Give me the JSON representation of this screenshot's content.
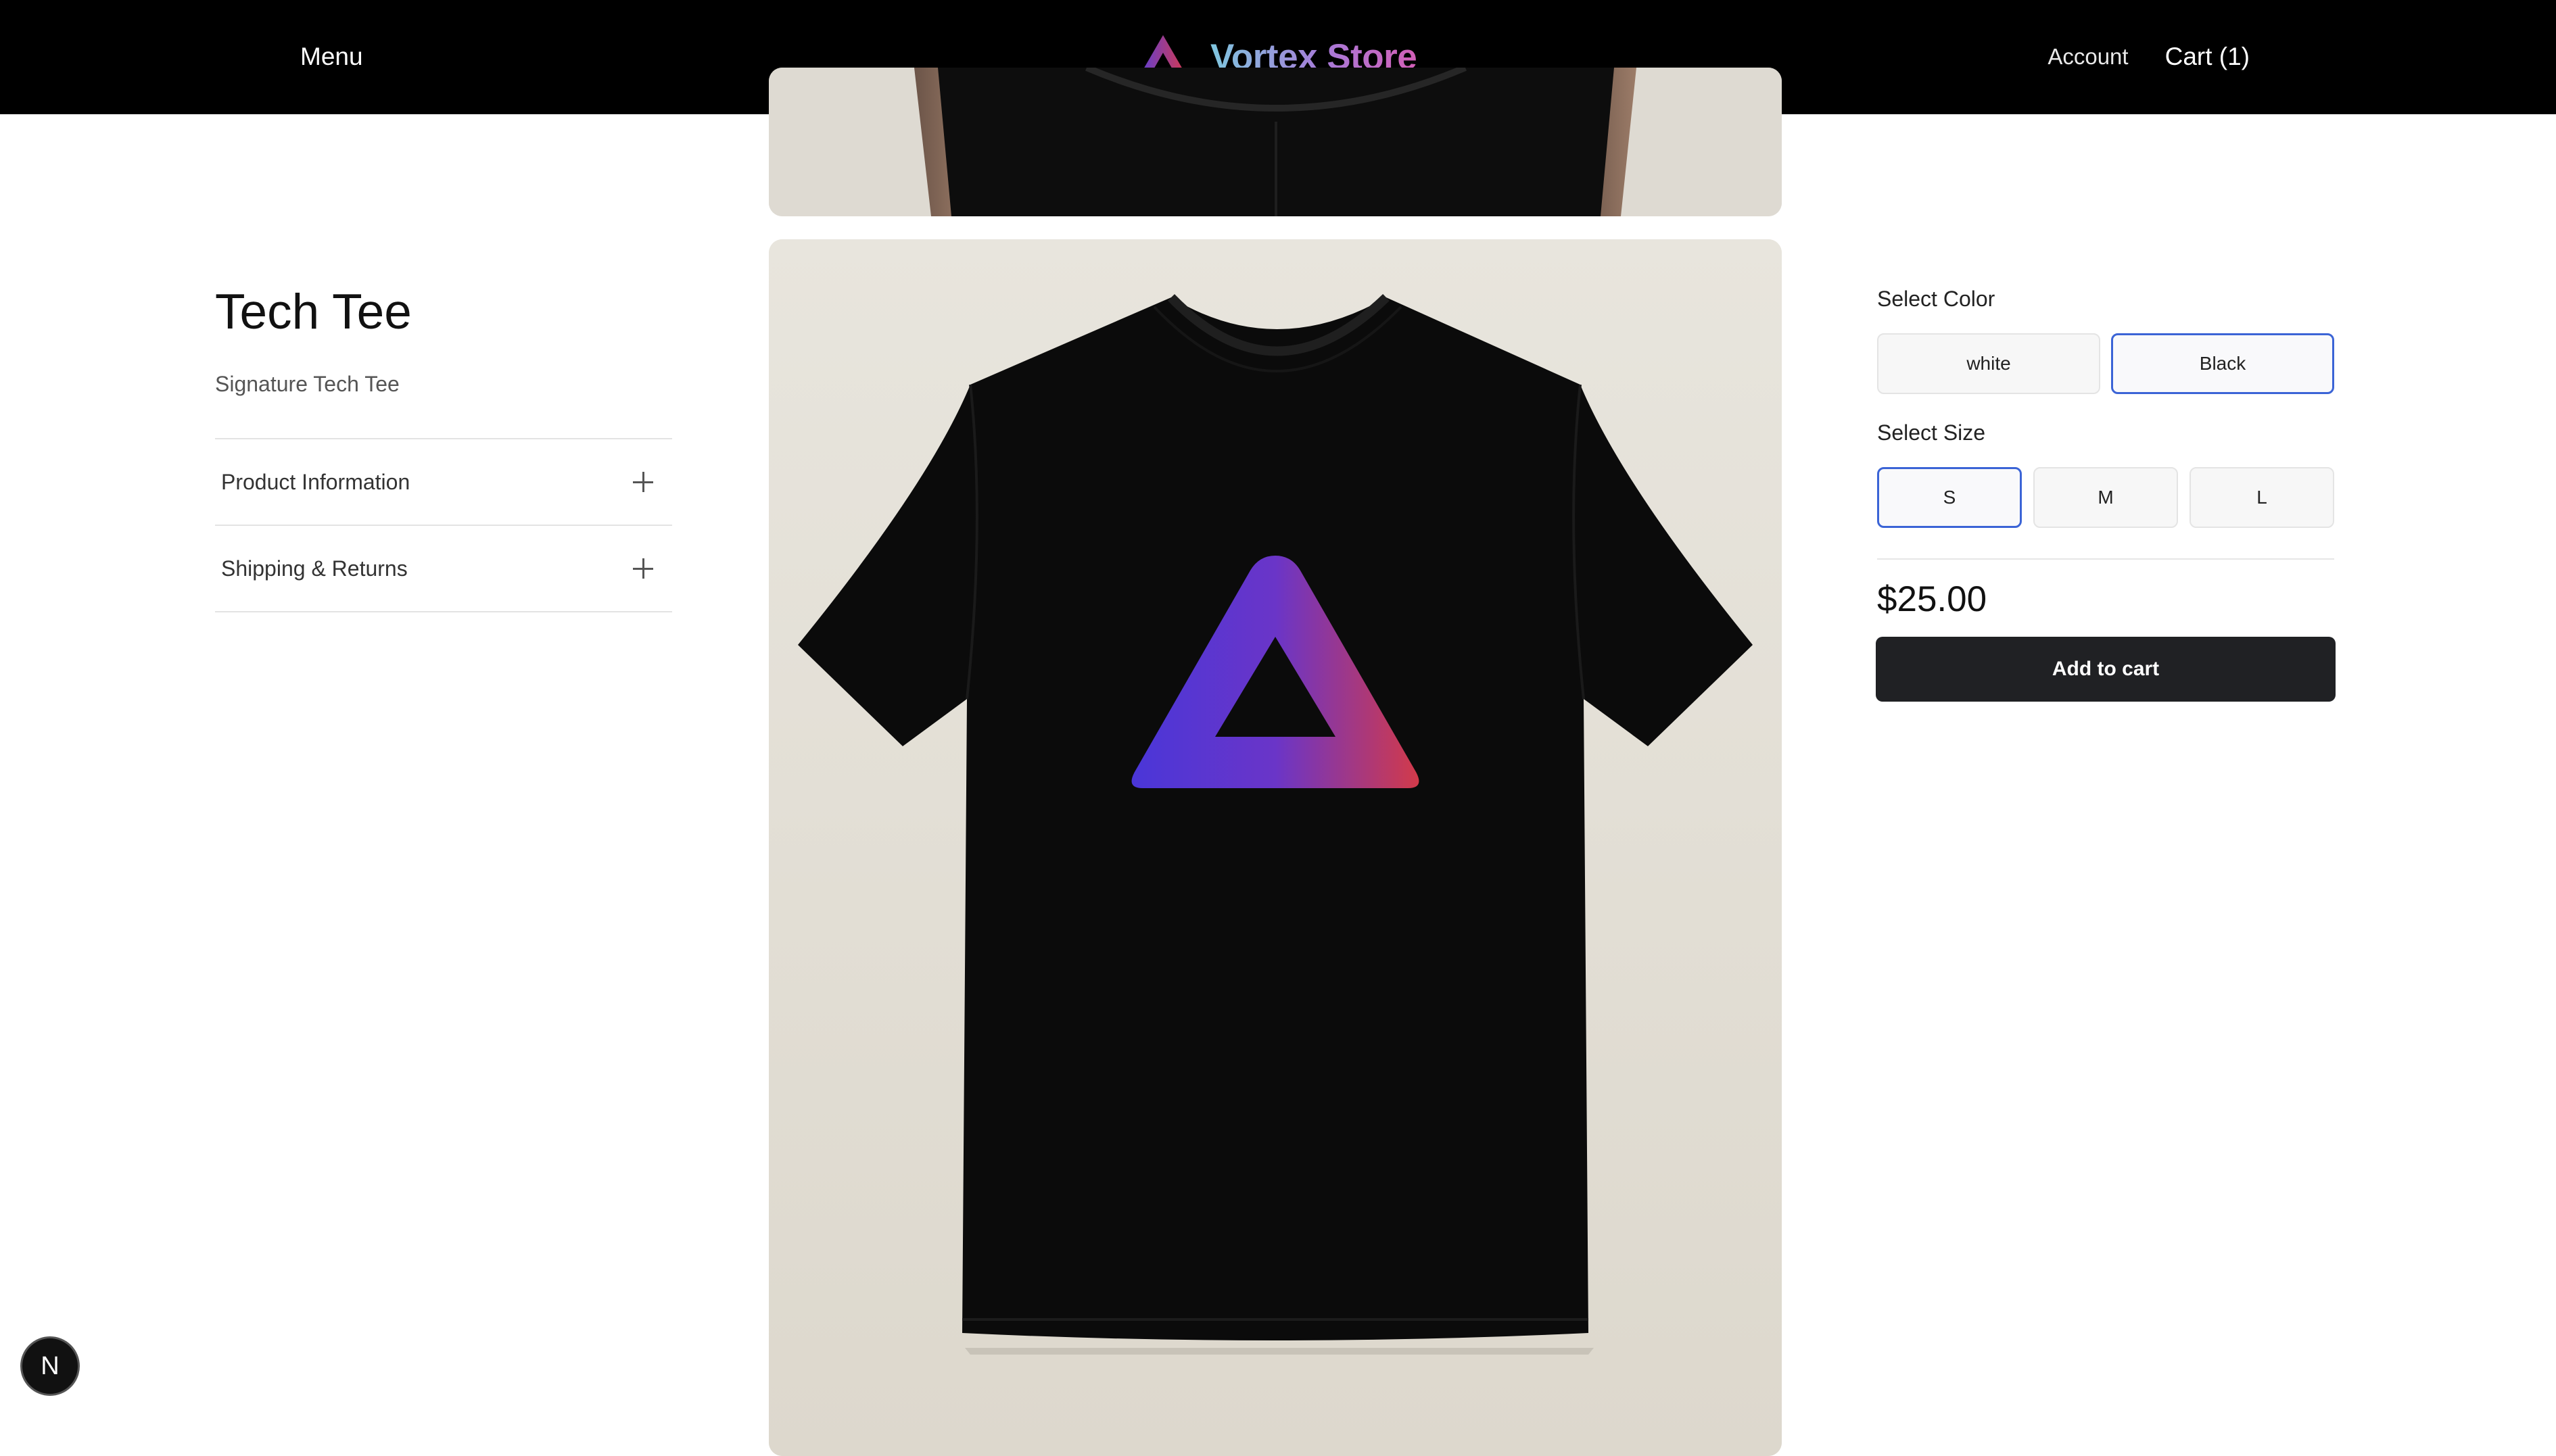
{
  "header": {
    "menu_label": "Menu",
    "brand_name": "Vortex Store",
    "account_label": "Account",
    "cart_label": "Cart (1)"
  },
  "product": {
    "title": "Tech Tee",
    "subtitle": "Signature Tech Tee",
    "price": "$25.00"
  },
  "accordion": [
    {
      "label": "Product Information"
    },
    {
      "label": "Shipping & Returns"
    }
  ],
  "options": {
    "color_label": "Select Color",
    "colors": [
      "white",
      "Black"
    ],
    "selected_color": "Black",
    "size_label": "Select Size",
    "sizes": [
      "S",
      "M",
      "L"
    ],
    "selected_size": "S"
  },
  "actions": {
    "add_to_cart_label": "Add to cart"
  },
  "dev_badge": {
    "letter": "N"
  },
  "colors": {
    "header_bg": "#000000",
    "selected_border": "#3b64d6",
    "button_dark": "#202124",
    "logo_gradient_start": "#5b3fd6",
    "logo_gradient_end": "#d9394b"
  }
}
